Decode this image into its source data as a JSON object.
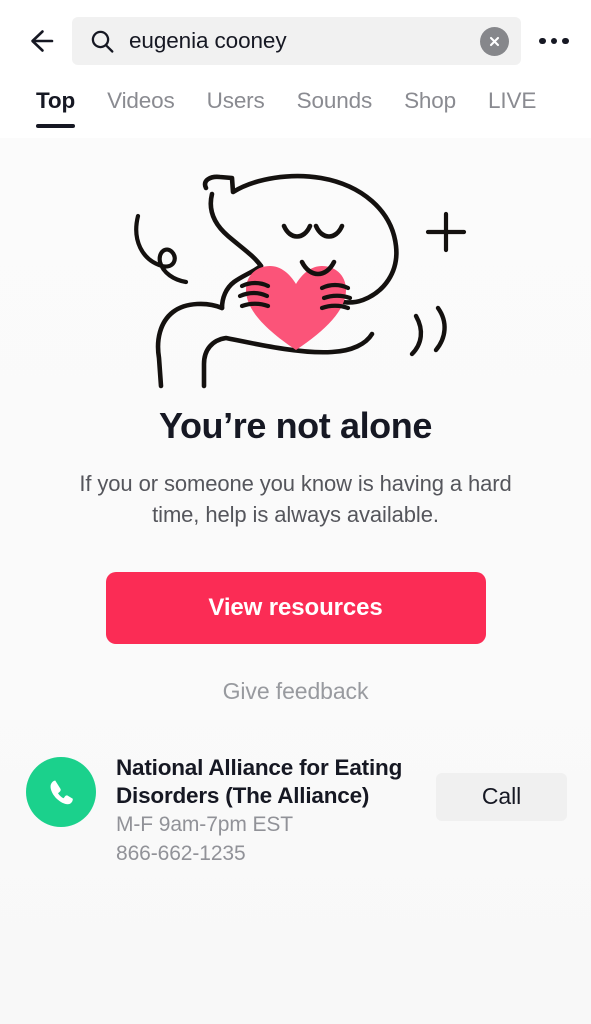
{
  "header": {
    "back_icon": "arrow-left-icon",
    "search": {
      "icon": "search-icon",
      "value": "eugenia cooney",
      "placeholder": "Search",
      "clear_icon": "close-circle-icon"
    },
    "more_icon": "more-horizontal-icon"
  },
  "tabs": {
    "items": [
      {
        "label": "Top",
        "active": true
      },
      {
        "label": "Videos",
        "active": false
      },
      {
        "label": "Users",
        "active": false
      },
      {
        "label": "Sounds",
        "active": false
      },
      {
        "label": "Shop",
        "active": false
      },
      {
        "label": "LIVE",
        "active": false
      }
    ]
  },
  "main": {
    "illustration_name": "person-hugging-heart-illustration",
    "headline": "You’re not alone",
    "subtitle": "If you or someone you know is having a hard time, help is always available.",
    "primary_button": "View resources",
    "feedback_link": "Give feedback"
  },
  "hotline": {
    "phone_icon": "phone-icon",
    "name": "National Alliance for Eating Disorders (The Alliance)",
    "hours": "M-F 9am-7pm EST",
    "number": "866-662-1235",
    "call_button": "Call"
  },
  "colors": {
    "accent_red": "#fb2c55",
    "heart_pink": "#fb5479",
    "phone_green": "#1bd18c",
    "text_primary": "#161823",
    "text_secondary": "#55565c",
    "text_muted": "#919298",
    "search_bg": "#f1f1f1",
    "call_bg": "#f0f0f0"
  }
}
